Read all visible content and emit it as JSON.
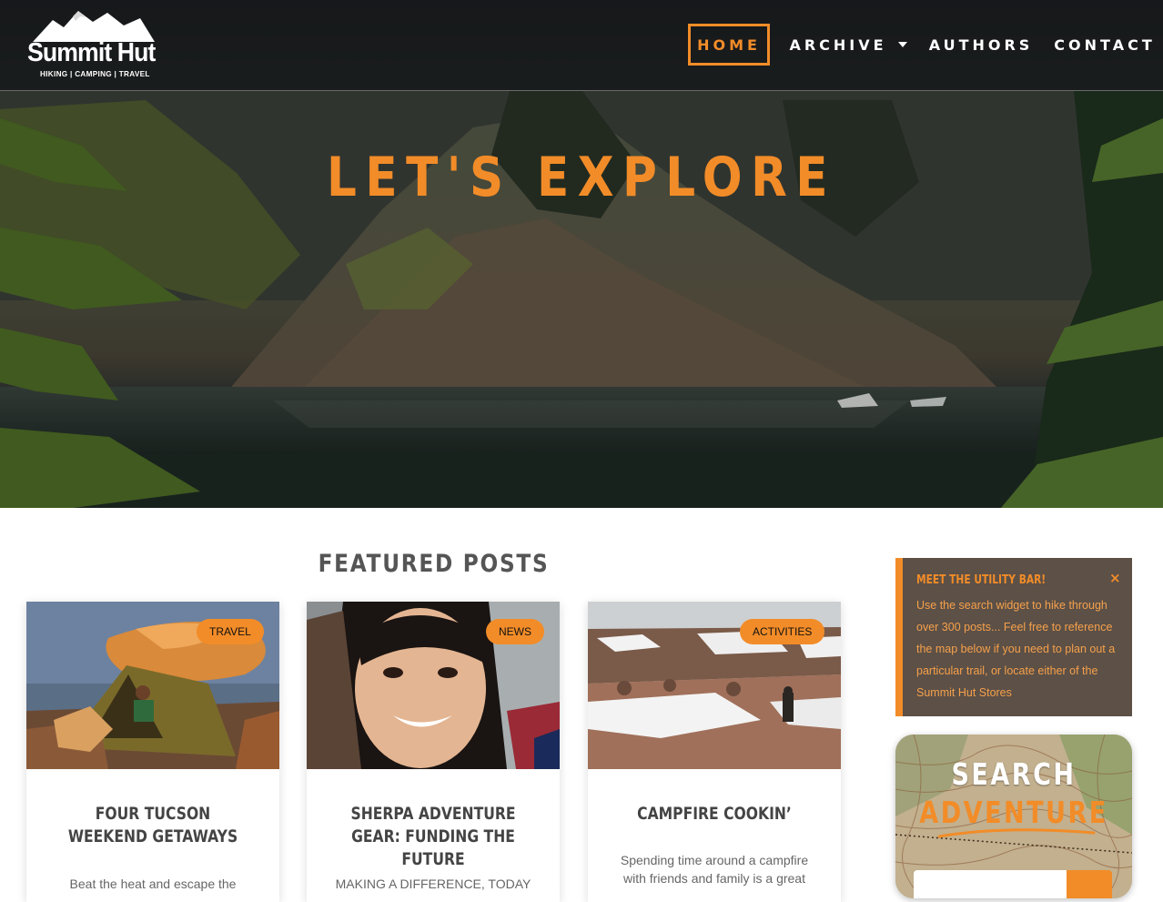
{
  "site": {
    "logo_name": "Summit Hut",
    "logo_tagline": "HIKING | CAMPING | TRAVEL"
  },
  "nav": {
    "home": "HOME",
    "archive": "ARCHIVE",
    "authors": "AUTHORS",
    "contact": "CONTACT",
    "active": "home"
  },
  "hero": {
    "title": "LET'S EXPLORE"
  },
  "featured": {
    "heading": "FEATURED POSTS",
    "posts": [
      {
        "category": "TRAVEL",
        "title": "FOUR TUCSON WEEKEND GETAWAYS",
        "excerpt": "Beat the heat and escape the"
      },
      {
        "category": "NEWS",
        "title": "SHERPA ADVENTURE GEAR: FUNDING THE FUTURE",
        "excerpt": "MAKING A DIFFERENCE, TODAY"
      },
      {
        "category": "ACTIVITIES",
        "title": "CAMPFIRE COOKIN’",
        "excerpt": "Spending time around a campfire with friends and family is a great"
      }
    ]
  },
  "utility_bar": {
    "title": "MEET THE UTILITY BAR!",
    "close": "×",
    "text": "Use the search widget to hike through over 300 posts... Feel free to reference the map below if you need to plan out a particular trail, or locate either of the Summit Hut Stores"
  },
  "search_widget": {
    "title_line1": "SEARCH",
    "title_line2": "ADVENTURE",
    "placeholder": ""
  },
  "colors": {
    "accent": "#f28c28",
    "header_bg": "#15171b",
    "utility_bg": "#5c5047",
    "heading_gray": "#555555"
  }
}
